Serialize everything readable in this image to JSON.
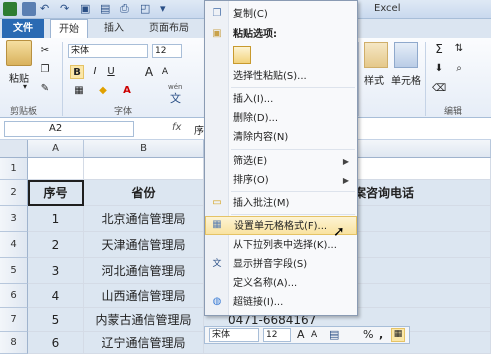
{
  "titlebar": {
    "title_left": "ic",
    "title_right": "Excel"
  },
  "tabs": {
    "file": "文件",
    "home": "开始",
    "insert": "插入",
    "layout": "页面布局"
  },
  "ribbon": {
    "paste_label": "粘贴",
    "clipboard_label": "剪贴板",
    "font_label": "字体",
    "font_name": "宋体",
    "font_size": "12",
    "style_label": "样式",
    "cells_label": "单元格",
    "edit_label": "编辑",
    "bold": "B",
    "underline": "U",
    "grow_font": "A",
    "shrink_font": "A",
    "wen_badge": "wén",
    "wen_char": "文"
  },
  "formula_bar": {
    "cell_ref": "A2",
    "fx": "fx",
    "content": "序"
  },
  "columns": [
    "A",
    "B"
  ],
  "rows": [
    {
      "num": "1",
      "a": "",
      "b": "",
      "rest": "话"
    },
    {
      "num": "2",
      "a": "序号",
      "b": "省份",
      "rest": "备案咨询电话"
    },
    {
      "num": "3",
      "a": "1",
      "b": "北京通信管理局",
      "rest": ""
    },
    {
      "num": "4",
      "a": "2",
      "b": "天津通信管理局",
      "rest": ""
    },
    {
      "num": "5",
      "a": "3",
      "b": "河北通信管理局",
      "rest": ""
    },
    {
      "num": "6",
      "a": "4",
      "b": "山西通信管理局",
      "rest": ""
    },
    {
      "num": "7",
      "a": "5",
      "b": "内蒙古通信管理局",
      "rest": "0471-6684167"
    },
    {
      "num": "8",
      "a": "6",
      "b": "辽宁通信管理局",
      "rest": ""
    }
  ],
  "context_menu": {
    "copy": "复制(C)",
    "paste_options": "粘贴选项:",
    "paste_special": "选择性粘贴(S)...",
    "insert": "插入(I)...",
    "delete": "删除(D)...",
    "clear": "清除内容(N)",
    "filter": "筛选(E)",
    "sort": "排序(O)",
    "insert_comment": "插入批注(M)",
    "format_cells": "设置单元格格式(F)...",
    "dropdown_pick": "从下拉列表中选择(K)...",
    "phonetic": "显示拼音字段(S)",
    "define_name": "定义名称(A)...",
    "hyperlink": "超链接(I)..."
  },
  "mini_toolbar": {
    "font_name": "宋体",
    "font_size": "12",
    "percent": "%",
    "comma": ","
  },
  "colors": {
    "file_tab": "#2a6ab3",
    "selection_fill": "#dce6f1",
    "menu_highlight": "#f9e3a0"
  }
}
